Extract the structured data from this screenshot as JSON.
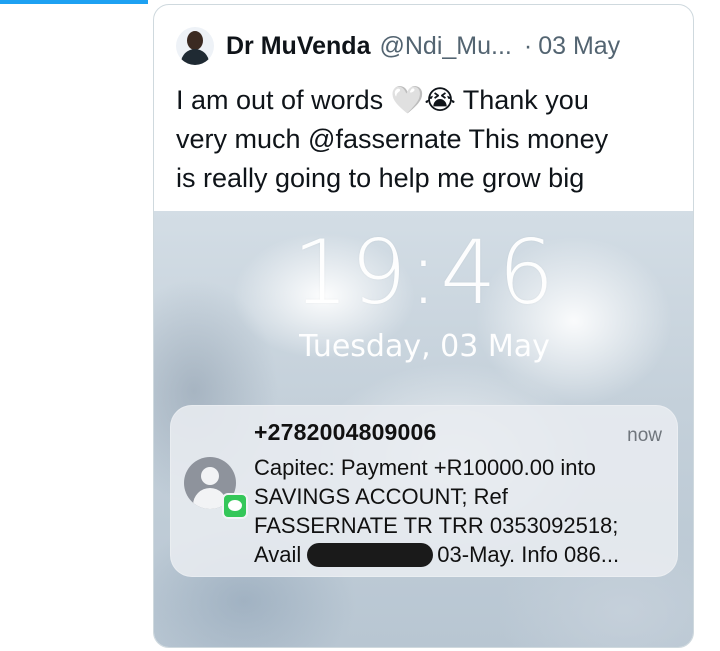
{
  "tweet": {
    "display_name": "Dr MuVenda",
    "handle": "@Ndi_Mu...",
    "separator": "·",
    "date": "03 May",
    "text": "I am out of words 🤍😭 Thank you\nvery much @fassernate  This money\nis really going to help me grow big"
  },
  "lockscreen": {
    "time": "19:46",
    "date": "Tuesday, 03 May"
  },
  "notification": {
    "sender": "+2782004809006",
    "time": "now",
    "line1": "Capitec: Payment +R10000.00 into",
    "line2": "SAVINGS ACCOUNT; Ref",
    "line3": "FASSERNATE TR TRR 0353092518;",
    "line4_start": "Avail",
    "line4_end": "03-May. Info 086..."
  },
  "colors": {
    "accent": "#1da1f2",
    "notification_badge": "#34c759"
  }
}
